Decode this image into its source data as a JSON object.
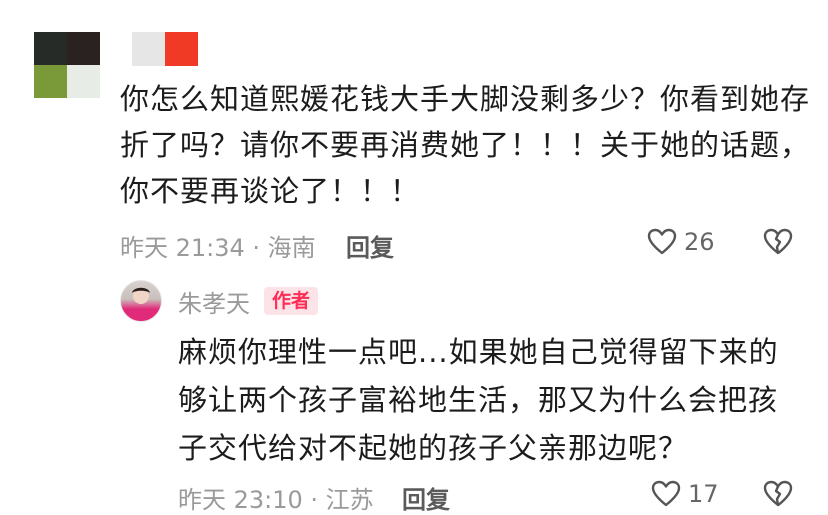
{
  "comment": {
    "text": "你怎么知道熙媛花钱大手大脚没剩多少？你看到她存折了吗？请你不要再消费她了！！！关于她的话题，你不要再谈论了！！！",
    "meta": "昨天 21:34 · 海南",
    "reply_label": "回复",
    "likes": "26"
  },
  "reply": {
    "author": "朱孝天",
    "badge": "作者",
    "text": "麻烦你理性一点吧...如果她自己觉得留下来的够让两个孩子富裕地生活，那又为什么会把孩子交代给对不起她的孩子父亲那边呢？",
    "meta": "昨天 23:10 · 江苏",
    "reply_label": "回复",
    "likes": "17"
  },
  "icons": {
    "like": "heart-outline-icon",
    "dislike": "broken-heart-icon"
  },
  "colors": {
    "badge_text": "#ff2d55",
    "badge_bg": "#fbe3e8",
    "meta_text": "#9a9a9a"
  }
}
